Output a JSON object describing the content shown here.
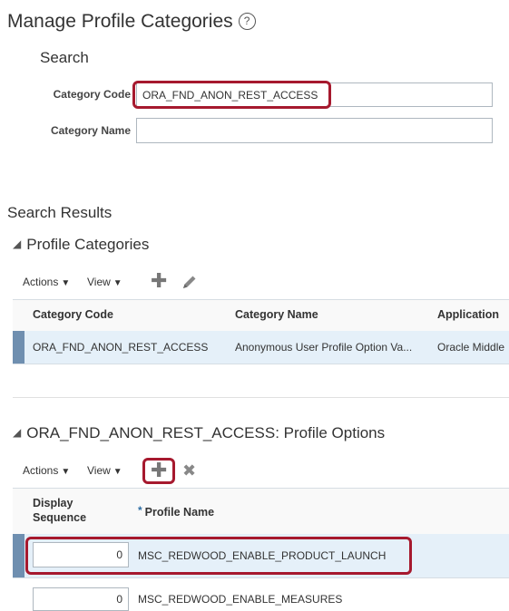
{
  "page": {
    "title": "Manage Profile Categories",
    "help_glyph": "?"
  },
  "search": {
    "heading": "Search",
    "category_code_label": "Category Code",
    "category_code_value": "ORA_FND_ANON_REST_ACCESS",
    "category_name_label": "Category Name",
    "category_name_value": ""
  },
  "results": {
    "heading": "Search Results"
  },
  "profile_categories": {
    "title": "Profile Categories",
    "toolbar": {
      "actions_label": "Actions",
      "view_label": "View"
    },
    "columns": [
      "Category Code",
      "Category Name",
      "Application"
    ],
    "rows": [
      {
        "code": "ORA_FND_ANON_REST_ACCESS",
        "name": "Anonymous User Profile Option Va...",
        "application": "Oracle Middle"
      }
    ]
  },
  "profile_options": {
    "title": "ORA_FND_ANON_REST_ACCESS: Profile Options",
    "toolbar": {
      "actions_label": "Actions",
      "view_label": "View"
    },
    "columns": {
      "display_sequence_line1": "Display",
      "display_sequence_line2": "Sequence",
      "profile_name": "Profile Name",
      "required_mark": "*"
    },
    "rows": [
      {
        "sequence": "0",
        "profile_name": "MSC_REDWOOD_ENABLE_PRODUCT_LAUNCH"
      },
      {
        "sequence": "0",
        "profile_name": "MSC_REDWOOD_ENABLE_MEASURES"
      }
    ]
  },
  "colors": {
    "highlight": "#a6192e",
    "selected_row": "#e5f0f9",
    "row_marker": "#6f8fb0"
  },
  "icons": {
    "help": "help-circle-icon",
    "add": "plus-icon",
    "edit": "pencil-icon",
    "delete": "x-icon",
    "disclosure": "triangle-down-icon"
  }
}
